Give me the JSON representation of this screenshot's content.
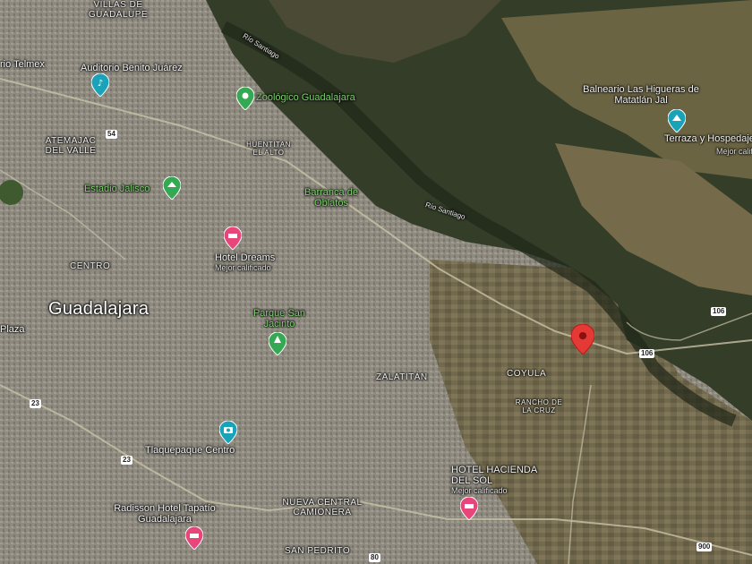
{
  "map": {
    "areas": {
      "villas": "VILLAS DE GUADALUPE",
      "atemajac": "ATEMAJAC DEL VALLE",
      "huentitan": "HUENTITAN EL ALTO",
      "centro": "CENTRO",
      "zalatitan": "ZALATITÁN",
      "coyula": "COYULA",
      "rancho": "RANCHO DE LA CRUZ",
      "nueva_central": "NUEVA CENTRAL CAMIONERA",
      "san_pedro": "SAN PEDRITO"
    },
    "city": "Guadalajara",
    "pois": {
      "telmex": "rio Telmex",
      "auditorio": "Auditorio Benito Juárez",
      "zoologico": "Zoológico Guadalajara",
      "estadio": "Estadio Jalisco",
      "barranca": "Barranca de Oblatos",
      "hotel_dreams": "Hotel Dreams",
      "hotel_dreams_sub": "Mejor calificado",
      "parque": "Parque San Jacinto",
      "plaza": "Plaza",
      "tlaquepaque": "Tlaquepaque Centro",
      "radisson": "Radisson Hotel Tapatío Guadalajara",
      "hacienda": "HOTEL HACIENDA DEL SOL",
      "hacienda_sub": "Mejor calificado",
      "balneario": "Balneario Las Higueras de Matatlán Jal",
      "terraza": "Terraza y Hospedaje",
      "terraza_sub": "Mejor calif"
    },
    "rivers": {
      "r1": "Río Santiago",
      "r2": "Río Santiago"
    },
    "roads": {
      "r54": "54",
      "r23": "23",
      "r23b": "23",
      "r80": "80",
      "r106a": "106",
      "r106b": "106",
      "r900": "900"
    },
    "colors": {
      "urban": "#8c877c",
      "forest": "#2f3a25",
      "farmland": "#7a6e4e",
      "selected_pin": "#e53935",
      "hotel_pin": "#e8457a",
      "park_pin": "#34a853",
      "attraction_pin": "#1aa3b8"
    }
  }
}
